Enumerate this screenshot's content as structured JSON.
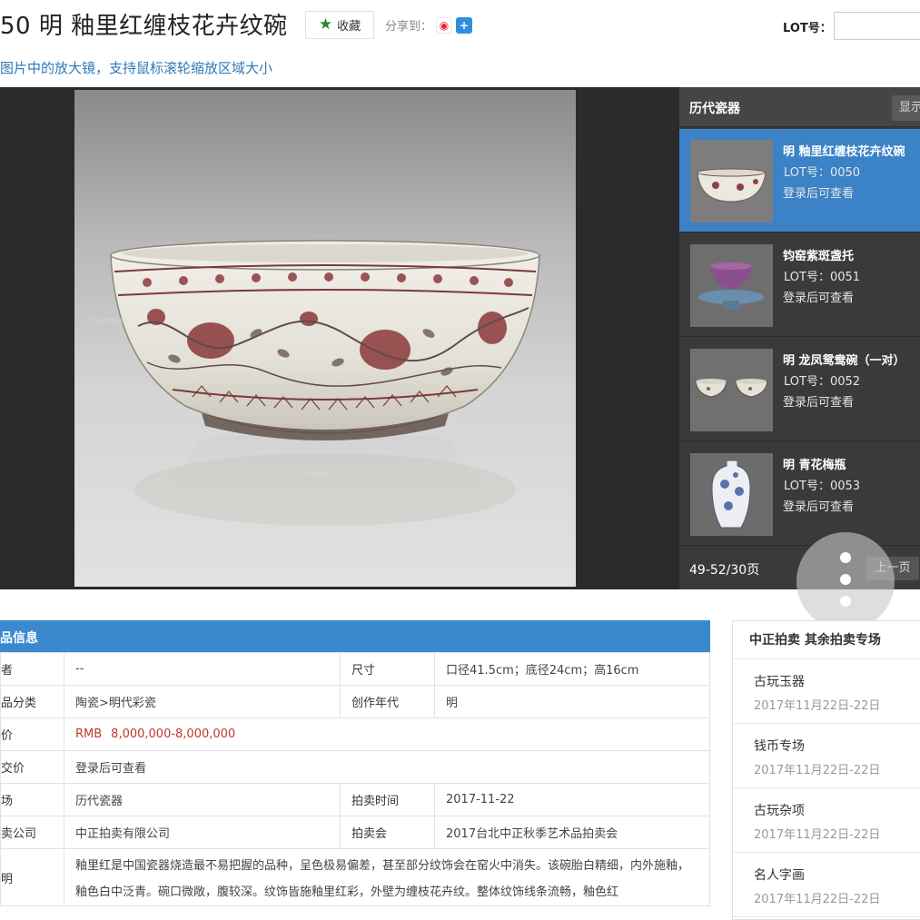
{
  "header": {
    "title": "50 明 釉里红缠枝花卉纹碗",
    "favorite_label": "收藏",
    "share_label": "分享到：",
    "lot_label": "LOT号：",
    "lot_input_value": ""
  },
  "magnifier_tip": "图片中的放大镜，支持鼠标滚轮缩放区域大小",
  "viewer": {
    "watermark": "©emaker"
  },
  "thumbs": {
    "title": "历代瓷器",
    "show_label": "显示",
    "items": [
      {
        "name": "明 釉里红缠枝花卉纹碗",
        "lot": "LOT号：0050",
        "login": "登录后可查看"
      },
      {
        "name": "钧窑紫斑盏托",
        "lot": "LOT号：0051",
        "login": "登录后可查看"
      },
      {
        "name": "明 龙凤鸳鸯碗（一对）",
        "lot": "LOT号：0052",
        "login": "登录后可查看"
      },
      {
        "name": "明 青花梅瓶",
        "lot": "LOT号：0053",
        "login": "登录后可查看"
      }
    ],
    "pager": "49-52/30页",
    "prev_label": "上一页"
  },
  "info": {
    "title": "品信息",
    "rows": {
      "author_k": "者",
      "author_v": "--",
      "size_k": "尺寸",
      "size_v": "口径41.5cm；底径24cm；高16cm",
      "category_k": "品分类",
      "category_v": "陶瓷>明代彩瓷",
      "era_k": "创作年代",
      "era_v": "明",
      "estimate_k": "价",
      "estimate_currency": "RMB",
      "estimate_v": "8,000,000-8,000,000",
      "deal_k": "交价",
      "deal_v": "登录后可查看",
      "session_k": "场",
      "session_v": "历代瓷器",
      "date_k": "拍卖时间",
      "date_v": "2017-11-22",
      "company_k": "卖公司",
      "company_v": "中正拍卖有限公司",
      "auction_k": "拍卖会",
      "auction_v": "2017台北中正秋季艺术品拍卖会",
      "desc_k": "明",
      "desc_v": "釉里红是中国瓷器烧造最不易把握的品种，呈色极易偏差，甚至部分纹饰会在窑火中消失。该碗胎白精细，内外施釉，釉色白中泛青。碗口微敞，腹较深。纹饰皆施釉里红彩，外壁为缠枝花卉纹。整体纹饰线条流畅，釉色红"
    }
  },
  "side": {
    "title": "中正拍卖 其余拍卖专场",
    "items": [
      {
        "name": "古玩玉器",
        "date": "2017年11月22日-22日"
      },
      {
        "name": "钱币专场",
        "date": "2017年11月22日-22日"
      },
      {
        "name": "古玩杂项",
        "date": "2017年11月22日-22日"
      },
      {
        "name": "名人字画",
        "date": "2017年11月22日-22日"
      }
    ]
  },
  "colors": {
    "accent_blue": "#3a89cf",
    "active_thumb": "#3b82c6",
    "price_red": "#c0392b",
    "link_blue": "#2e78b8"
  }
}
